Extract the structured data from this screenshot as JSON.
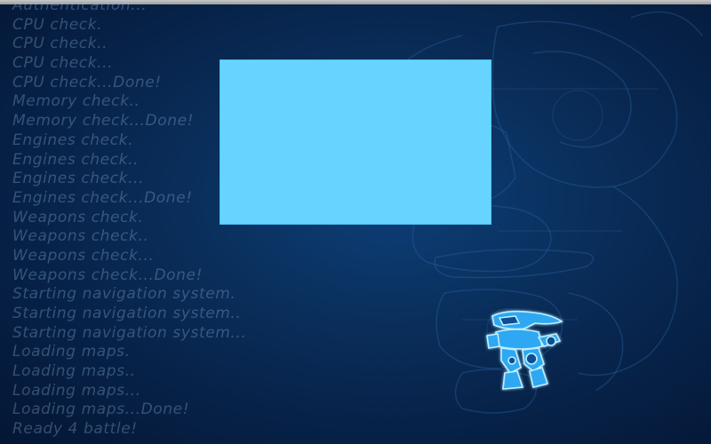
{
  "boot_log": {
    "lines": [
      "Authentication...",
      "CPU check.",
      "CPU check..",
      "CPU check...",
      "CPU check...Done!",
      "Memory check..",
      "Memory check...Done!",
      "Engines check.",
      "Engines check..",
      "Engines check...",
      "Engines check...Done!",
      "Weapons check.",
      "Weapons check..",
      "Weapons check...",
      "Weapons check...Done!",
      "Starting navigation system.",
      "Starting navigation system..",
      "Starting navigation system...",
      "Loading maps.",
      "Loading maps..",
      "Loading maps...",
      "Loading maps...Done!",
      "Ready 4 battle!"
    ]
  },
  "colors": {
    "background": "#0a2f5c",
    "panel": "#66d4ff",
    "log_text": "#96bee6",
    "robot_glow": "#3fb8ff"
  },
  "icons": {
    "robot": "mech-robot-icon",
    "background_art": "mech-blueprint-art"
  }
}
